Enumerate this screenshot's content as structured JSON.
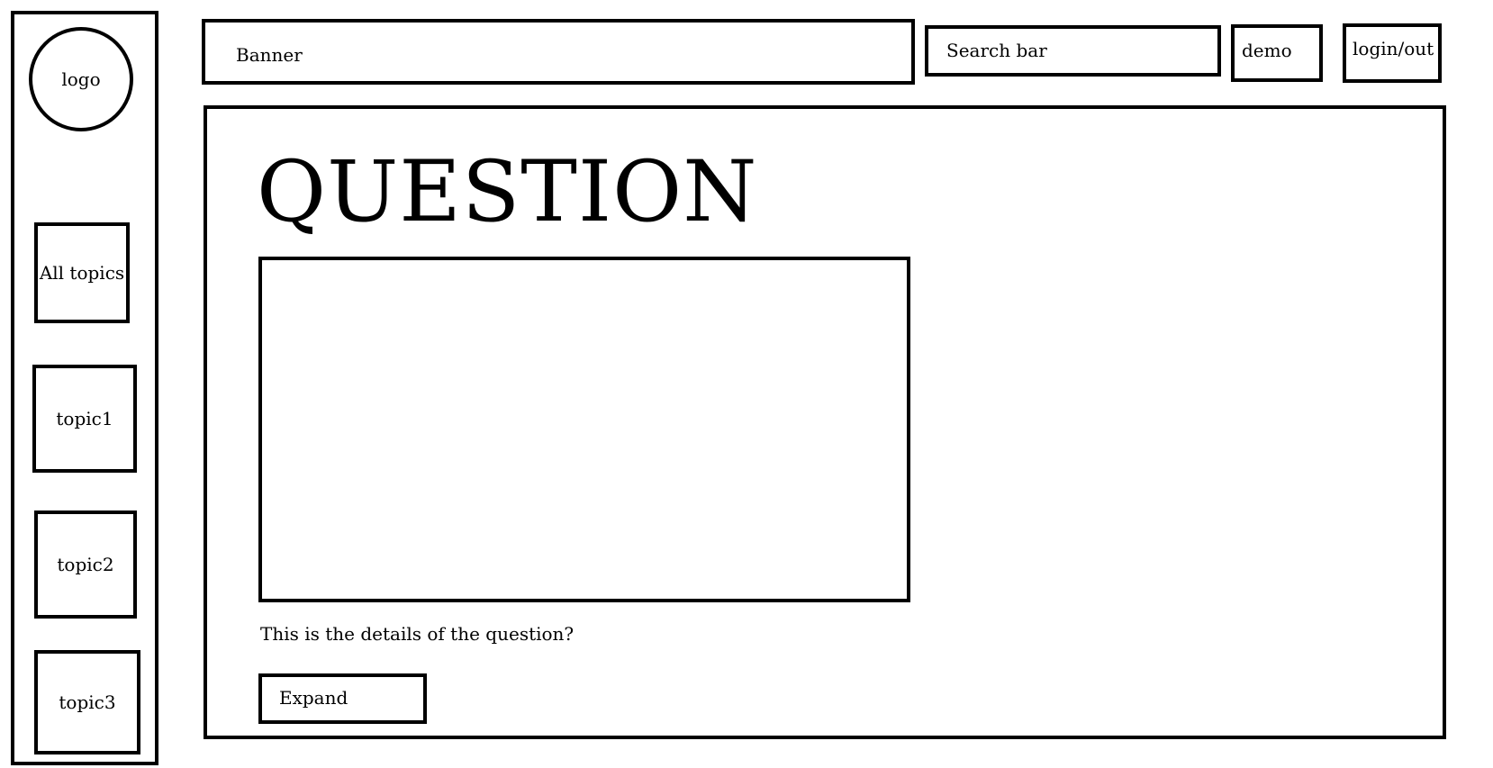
{
  "sidebar": {
    "logo": "logo",
    "items": [
      {
        "label": "All topics"
      },
      {
        "label": "topic1"
      },
      {
        "label": "topic2"
      },
      {
        "label": "topic3"
      }
    ]
  },
  "header": {
    "banner": "Banner",
    "search_placeholder": "Search bar",
    "demo": "demo",
    "login": "login/out"
  },
  "main": {
    "question_title": "QUESTION",
    "details": "This is the details of the question?",
    "expand_label": "Expand"
  }
}
